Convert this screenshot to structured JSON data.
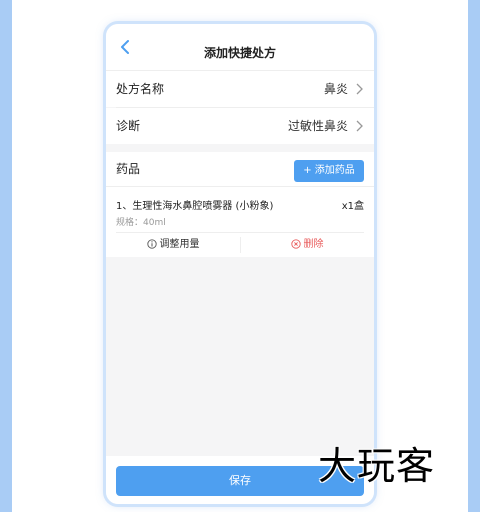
{
  "header": {
    "title": "添加快捷处方"
  },
  "form": {
    "name_label": "处方名称",
    "name_value": "鼻炎",
    "diagnosis_label": "诊断",
    "diagnosis_value": "过敏性鼻炎"
  },
  "medicine": {
    "section_label": "药品",
    "add_label": "+ 添加药品",
    "items": [
      {
        "name": "1、生理性海水鼻腔喷雾器 (小粉象)",
        "quantity": "x1盒",
        "spec": "规格：40ml",
        "adjust_label": "调整用量",
        "delete_label": "删除"
      }
    ]
  },
  "footer": {
    "save_label": "保存"
  },
  "watermark": {
    "text": "大玩客"
  },
  "colors": {
    "accent": "#4e9ff0",
    "danger": "#e85a5a",
    "page_bg": "#a9ccf5"
  }
}
